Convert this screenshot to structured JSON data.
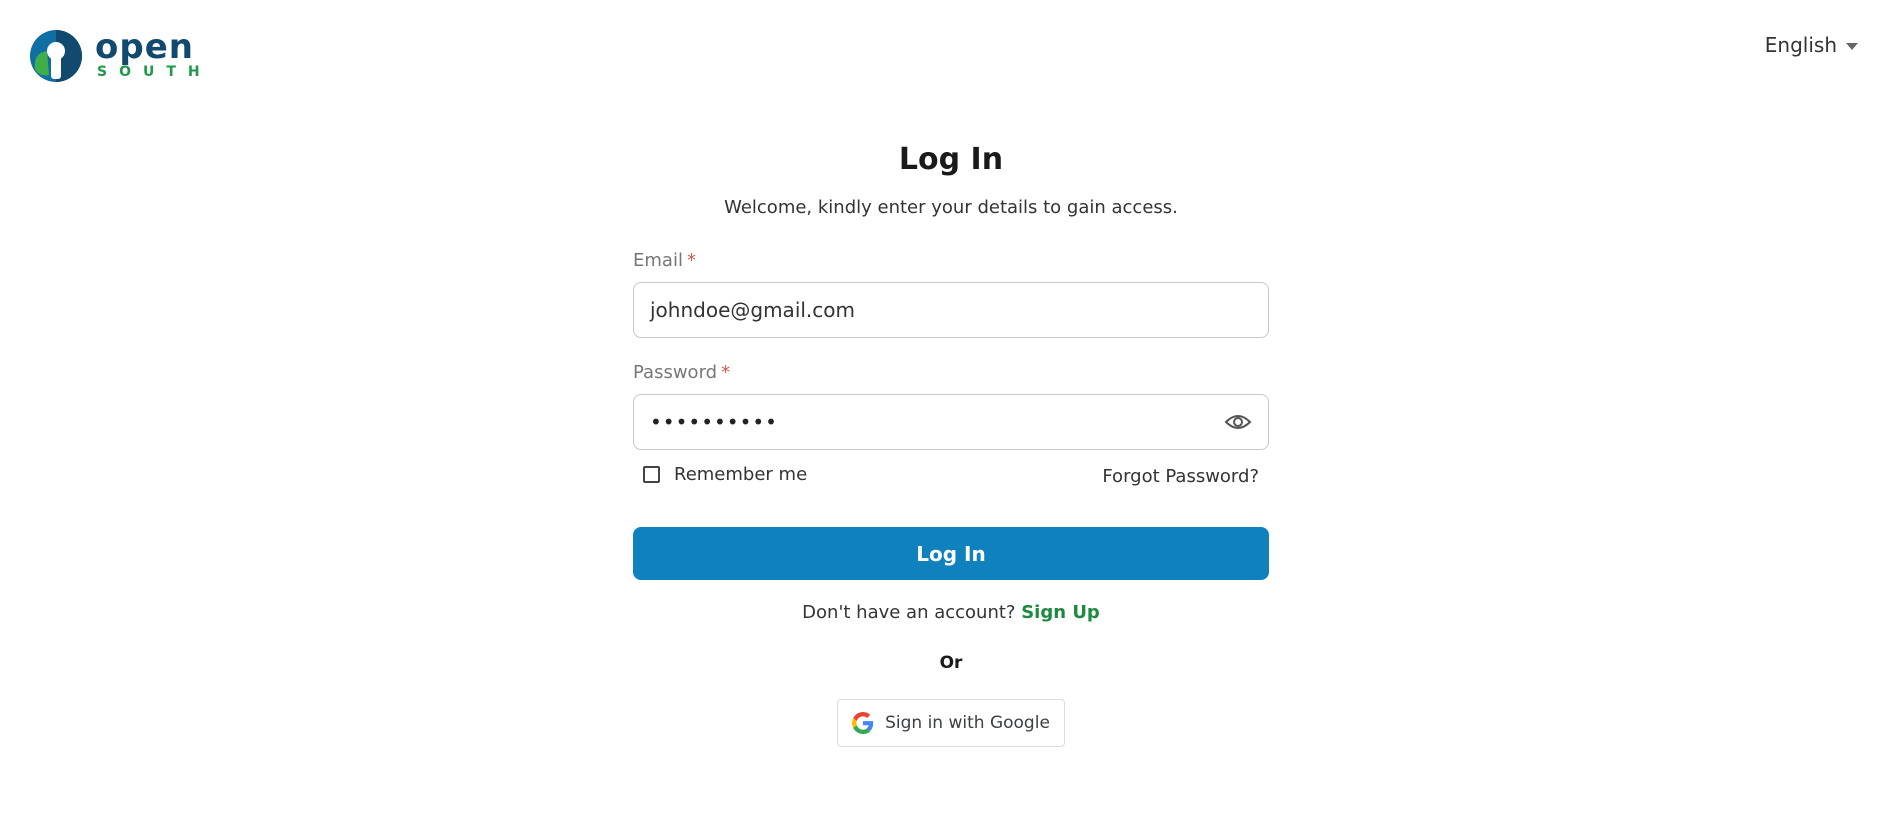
{
  "header": {
    "logo": {
      "top": "open",
      "bottom": "SOUTH"
    },
    "language": {
      "selected": "English"
    }
  },
  "form": {
    "title": "Log In",
    "subtitle": "Welcome, kindly enter your details to gain access.",
    "email": {
      "label": "Email",
      "required_mark": "*",
      "value": "johndoe@gmail.com"
    },
    "password": {
      "label": "Password",
      "required_mark": "*",
      "masked_value": "••••••••••"
    },
    "remember_label": "Remember me",
    "remember_checked": false,
    "forgot_label": "Forgot Password?",
    "submit_label": "Log In",
    "signup_prompt": "Don't have an account?",
    "signup_label": "Sign Up",
    "or_label": "Or",
    "google_label": "Sign in with Google"
  },
  "colors": {
    "primary": "#0f82be",
    "brand_dark": "#12496e",
    "brand_green": "#1e9a4a",
    "link_green": "#1e8a3e",
    "required": "#d9534f"
  },
  "icons": [
    "logo-mark-icon",
    "chevron-down-icon",
    "eye-icon",
    "google-icon"
  ]
}
